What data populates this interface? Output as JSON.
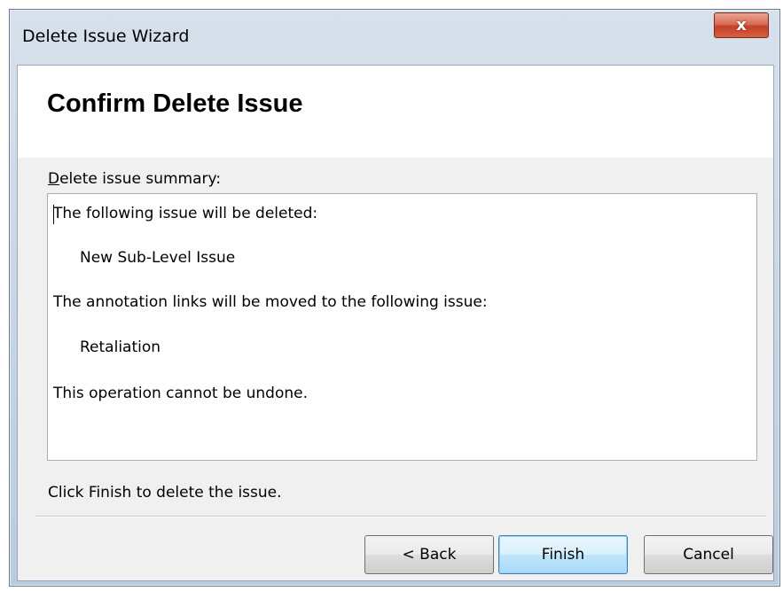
{
  "window": {
    "title": "Delete Issue Wizard",
    "close_glyph": "x"
  },
  "header": {
    "title": "Confirm Delete Issue"
  },
  "summary": {
    "label_accel": "D",
    "label_rest": "elete issue summary:",
    "lines": [
      "The following issue will be deleted:",
      "New Sub-Level Issue",
      "The annotation links will be moved to the following issue:",
      "Retaliation",
      "This operation cannot be undone."
    ]
  },
  "footer": {
    "instruction": "Click Finish to delete the issue."
  },
  "buttons": {
    "back": "< Back",
    "finish": "Finish",
    "cancel": "Cancel"
  },
  "colors": {
    "close_button": "#c4402a",
    "default_button_border": "#3c7fb1",
    "title_bar": "#c6d3e2"
  },
  "icons": {
    "close": "close-icon"
  }
}
